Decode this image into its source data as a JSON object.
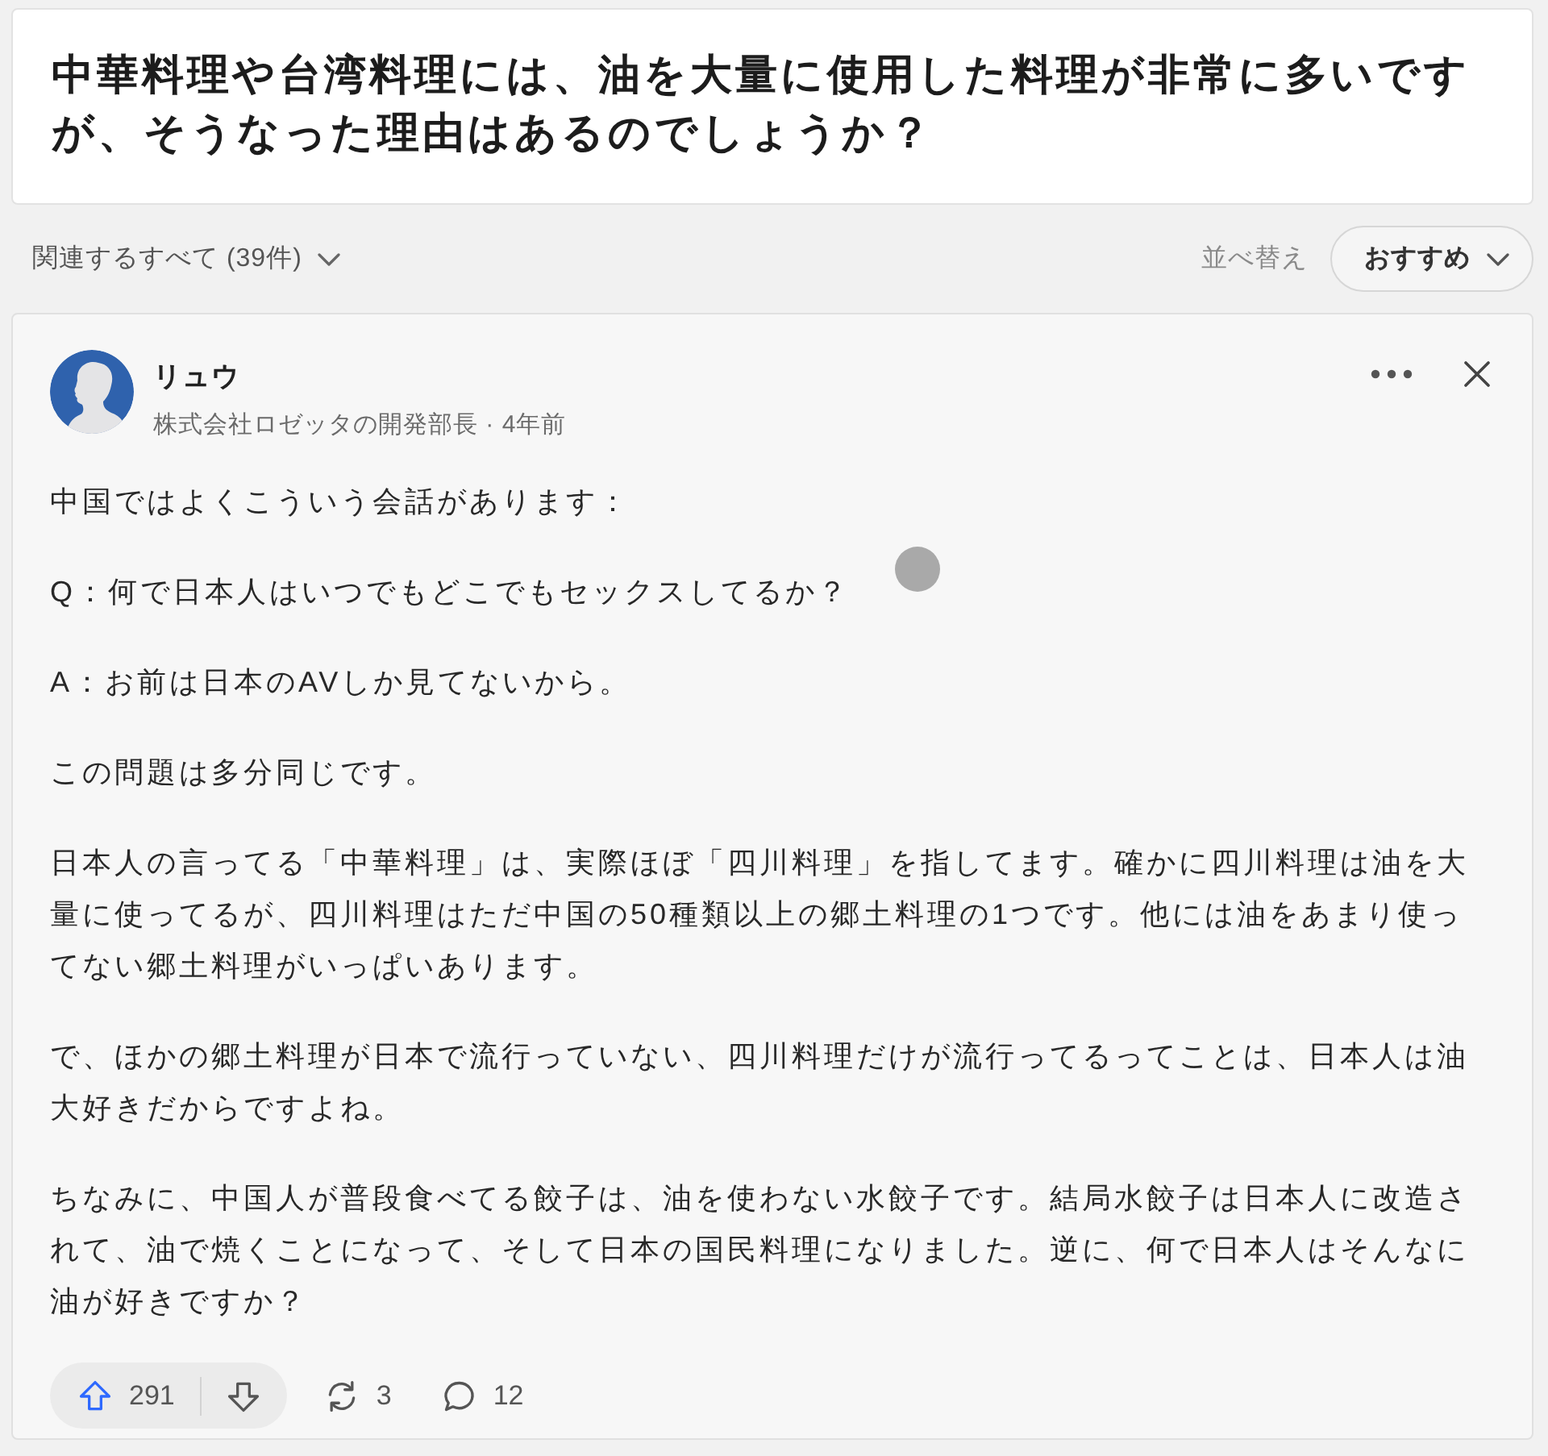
{
  "question": {
    "title": "中華料理や台湾料理には、油を大量に使用した料理が非常に多いですが、そうなった理由はあるのでしょうか？"
  },
  "filter_bar": {
    "filter": "関連するすべて (39件)",
    "sort_label": "並べ替え",
    "sort_value": "おすすめ"
  },
  "answer": {
    "author": "リュウ",
    "byline": "株式会社ロゼッタの開発部長 · 4年前",
    "paragraphs": [
      "中国ではよくこういう会話があります：",
      "Q：何で日本人はいつでもどこでもセックスしてるか？",
      "A：お前は日本のAVしか見てないから。",
      "この問題は多分同じです。",
      "日本人の言ってる「中華料理」は、実際ほぼ「四川料理」を指してます。確かに四川料理は油を大量に使ってるが、四川料理はただ中国の50種類以上の郷土料理の1つです。他には油をあまり使ってない郷土料理がいっぱいあります。",
      "で、ほかの郷土料理が日本で流行っていない、四川料理だけが流行ってるってことは、日本人は油大好きだからですよね。",
      "ちなみに、中国人が普段食べてる餃子は、油を使わない水餃子です。結局水餃子は日本人に改造されて、油で焼くことになって、そして日本の国民料理になりました。逆に、何で日本人はそんなに油が好きですか？"
    ],
    "upvotes": "291",
    "shares": "3",
    "comments": "12"
  }
}
